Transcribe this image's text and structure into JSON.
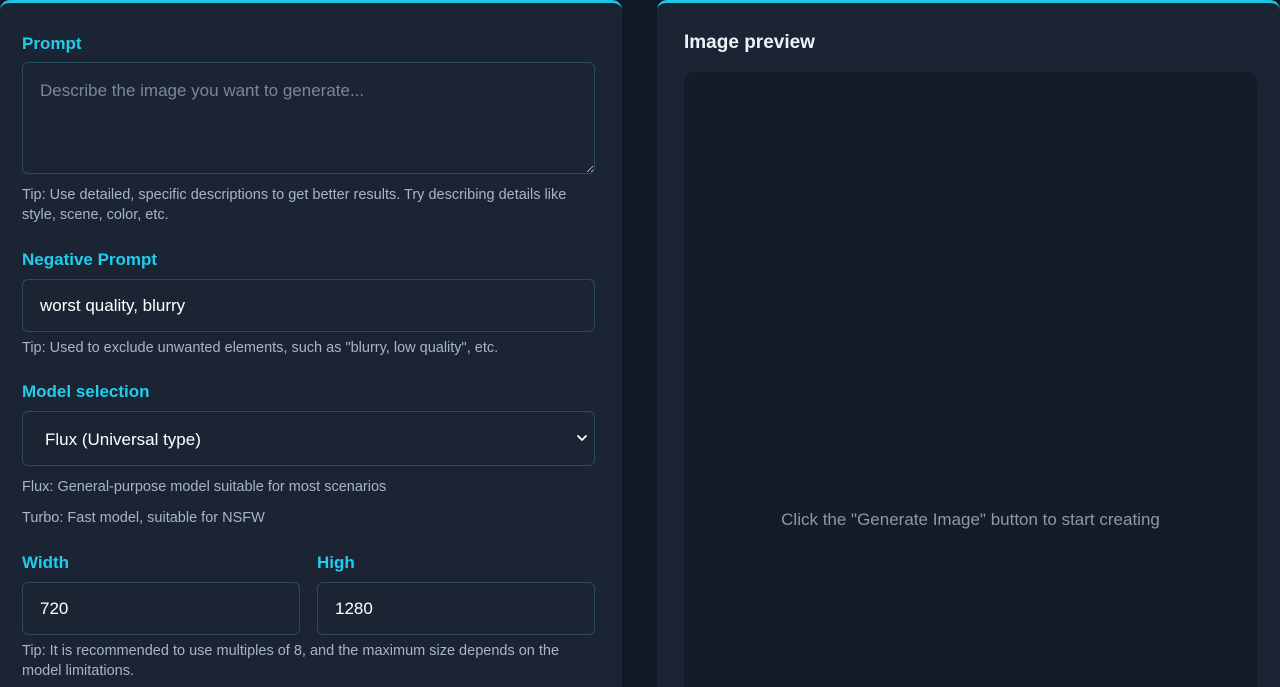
{
  "form": {
    "prompt": {
      "label": "Prompt",
      "placeholder": "Describe the image you want to generate...",
      "value": "",
      "tip": "Tip: Use detailed, specific descriptions to get better results. Try describing details like style, scene, color, etc."
    },
    "negative_prompt": {
      "label": "Negative Prompt",
      "value": "worst quality, blurry",
      "tip": "Tip: Used to exclude unwanted elements, such as \"blurry, low quality\", etc."
    },
    "model": {
      "label": "Model selection",
      "selected": "Flux (Universal type)",
      "descriptions": [
        "Flux: General-purpose model suitable for most scenarios",
        "Turbo: Fast model, suitable for NSFW"
      ]
    },
    "width": {
      "label": "Width",
      "value": "720"
    },
    "height": {
      "label": "High",
      "value": "1280"
    },
    "size_tip": "Tip: It is recommended to use multiples of 8, and the maximum size depends on the model limitations."
  },
  "preview": {
    "title": "Image preview",
    "placeholder": "Click the \"Generate Image\" button to start creating"
  },
  "colors": {
    "accent": "#1fc3e6",
    "label": "#22ccec",
    "panel": "#1a2433",
    "background": "#0f1924"
  },
  "icons": {
    "select_arrow": "chevron-down-icon"
  }
}
